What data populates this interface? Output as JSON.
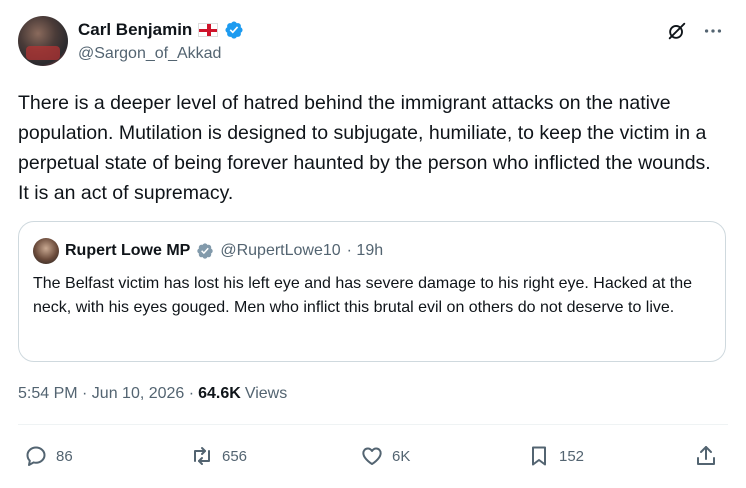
{
  "author": {
    "name": "Carl Benjamin",
    "handle": "@Sargon_of_Akkad"
  },
  "tweet": {
    "text": "There is a deeper level of hatred behind the immigrant attacks on the native population. Mutilation is designed to subjugate, humiliate, to keep the victim in a perpetual state of being forever haunted by the person who inflicted the wounds. It is an act of supremacy."
  },
  "quote": {
    "name": "Rupert Lowe MP",
    "handle": "@RupertLowe10",
    "time": "· 19h",
    "text": "The Belfast victim has lost his left eye and has severe damage to his right eye. Hacked at the neck, with his eyes gouged.  Men who inflict this brutal evil on others do not deserve to live."
  },
  "meta": {
    "time": "5:54 PM · Jun 10, 2026 ·",
    "views_count": "64.6K",
    "views_label": "Views"
  },
  "actions": {
    "replies": "86",
    "reposts": "656",
    "likes": "6K",
    "bookmarks": "152"
  },
  "colors": {
    "verified": "#1d9bf0",
    "secondary_text": "#536471",
    "border": "#cfd9de"
  }
}
